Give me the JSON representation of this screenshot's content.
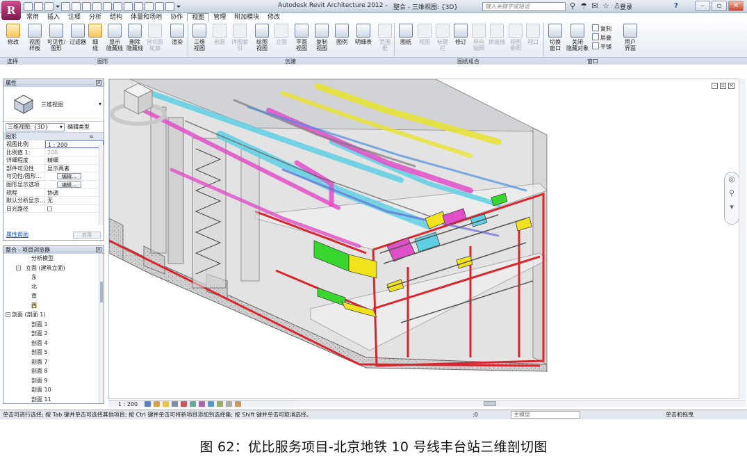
{
  "window": {
    "app_title": "Autodesk Revit Architecture 2012 -",
    "doc_title": "整合 - 三维视图: {3D}",
    "search_placeholder": "键入关键字或短语",
    "login": "登录",
    "help": "?",
    "controls": [
      "–",
      "▫",
      "✕"
    ]
  },
  "tabs": [
    "常用",
    "插入",
    "注释",
    "分析",
    "结构",
    "体量和场地",
    "协作",
    "视图",
    "管理",
    "附加模块",
    "修改"
  ],
  "active_tab": "视图",
  "ribbon": {
    "buttons": {
      "modify": "修改",
      "view_templates": "视图\n样板",
      "visibility_graphics": "可见性/\n图形",
      "filters": "过滤器",
      "thin_lines": "细\n线",
      "show_hidden": "显示\n隐藏线",
      "remove_hidden": "删除\n隐藏线",
      "cut_profile": "剖切面\n轮廓",
      "render": "渲染",
      "view_3d": "三维\n视图",
      "section": "剖面",
      "callout": "详图索引",
      "plan_views": "绘图\n视图",
      "elevation": "立面",
      "plan": "平面\n视图",
      "duplicate": "复制\n视图",
      "legends": "图例",
      "schedules": "明细表",
      "scope_box": "范围\n框",
      "sheet": "图纸",
      "view": "视图",
      "title_block": "标题\n栏",
      "revisions": "修订",
      "guide_grid": "导向\n轴网",
      "matchline": "拼接线",
      "view_reference": "视图\n参照",
      "viewports": "视口",
      "switch_windows": "切换\n窗口",
      "close_hidden": "关闭\n隐藏对象",
      "user_interface": "用户\n界面"
    },
    "window_small": [
      "复制",
      "层叠",
      "平铺"
    ],
    "panels": [
      "选择",
      "图形",
      "创建",
      "图纸组合",
      "窗口"
    ]
  },
  "properties": {
    "title": "属性",
    "type_name": "三维视图",
    "view_selector": "三维视图: {3D}",
    "edit_type": "编辑类型",
    "group": "图形",
    "rows": [
      {
        "k": "视图比例",
        "v": "1 : 200"
      },
      {
        "k": "比例值 1:",
        "v": "200"
      },
      {
        "k": "详细程度",
        "v": "精细"
      },
      {
        "k": "部件可见性",
        "v": "显示两者"
      },
      {
        "k": "可见性/图形...",
        "v": "编辑..."
      },
      {
        "k": "图形显示选项",
        "v": "编辑..."
      },
      {
        "k": "规程",
        "v": "协调"
      },
      {
        "k": "默认分析显示...",
        "v": "无"
      },
      {
        "k": "日光路径",
        "v": ""
      }
    ],
    "help_link": "属性帮助",
    "apply": "应用"
  },
  "browser": {
    "title": "整合 - 项目浏览器",
    "nodes": [
      {
        "t": "分析模型",
        "lvl": 2,
        "tog": ""
      },
      {
        "t": "立面 (建筑立面)",
        "lvl": 1,
        "tog": "–"
      },
      {
        "t": "东",
        "lvl": 2,
        "tog": ""
      },
      {
        "t": "北",
        "lvl": 2,
        "tog": ""
      },
      {
        "t": "南",
        "lvl": 2,
        "tog": ""
      },
      {
        "t": "西",
        "lvl": 2,
        "tog": "",
        "sel": true
      },
      {
        "t": "剖面 (剖面 1)",
        "lvl": 0,
        "tog": "–"
      },
      {
        "t": "剖面 1",
        "lvl": 2,
        "tog": ""
      },
      {
        "t": "剖面 2",
        "lvl": 2,
        "tog": ""
      },
      {
        "t": "剖面 4",
        "lvl": 2,
        "tog": ""
      },
      {
        "t": "剖面 5",
        "lvl": 2,
        "tog": ""
      },
      {
        "t": "剖面 7",
        "lvl": 2,
        "tog": ""
      },
      {
        "t": "剖面 8",
        "lvl": 2,
        "tog": ""
      },
      {
        "t": "剖面 9",
        "lvl": 2,
        "tog": ""
      },
      {
        "t": "剖面 10",
        "lvl": 2,
        "tog": ""
      },
      {
        "t": "剖面 11",
        "lvl": 2,
        "tog": ""
      }
    ]
  },
  "viewbar": {
    "scale": "1 : 200"
  },
  "status": {
    "text": "单击可进行选择; 按 Tab 键并单击可选择其他项目; 按 Ctrl 键并单击可将新项目添加到选择集; 按 Shift 键并单击可取消选择。",
    "zero": ":0",
    "model": "主模型",
    "press_drag": "单击和拖曳"
  },
  "caption": "图 62：优比服务项目-北京地铁 10 号线丰台站三维剖切图",
  "colors": {
    "section_red": "#d8262e",
    "pipe_cyan": "#5fd0e4",
    "pipe_magenta": "#e14fc8",
    "pipe_yellow": "#e8e32e",
    "equip_green": "#39d62f",
    "equip_yellow": "#f1e21e"
  }
}
